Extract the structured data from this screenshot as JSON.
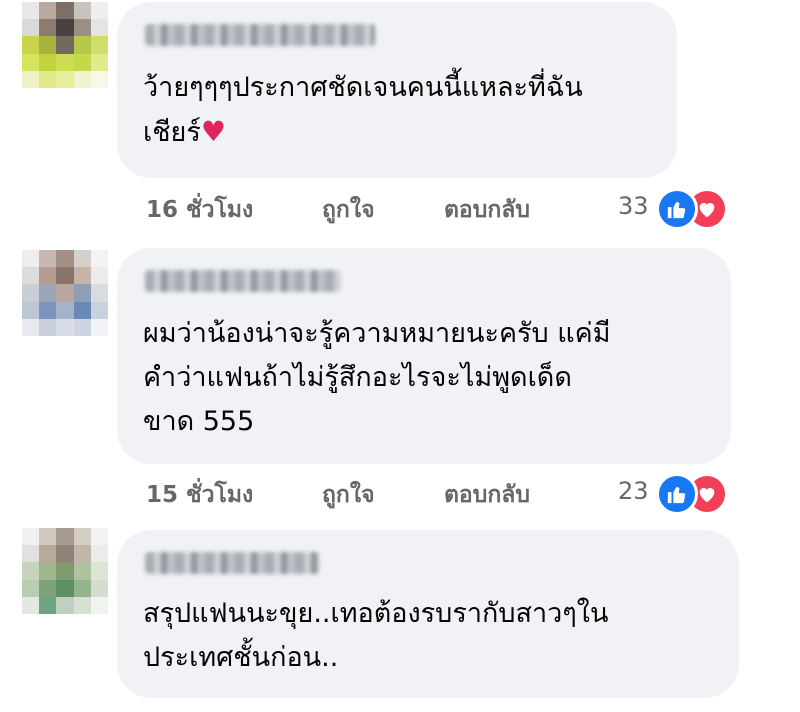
{
  "comments": [
    {
      "text": "ว้ายๆๆๆประกาศชัดเจนคนนี้แหละที่ฉัน\nเชียร์",
      "emoji": "♥",
      "time": "16 ชั่วโมง",
      "like_label": "ถูกใจ",
      "reply_label": "ตอบกลับ",
      "reaction_count": "33",
      "reactions": [
        "like-icon",
        "love-icon"
      ]
    },
    {
      "text": "ผมว่าน้องน่าจะรู้ความหมายนะครับ แค่มี\nคำว่าแฟนถ้าไม่รู้สึกอะไรจะไม่พูดเด็ด\nขาด 555",
      "time": "15 ชั่วโมง",
      "like_label": "ถูกใจ",
      "reply_label": "ตอบกลับ",
      "reaction_count": "23",
      "reactions": [
        "like-icon",
        "love-icon"
      ]
    },
    {
      "text": "สรุปแฟนนะขุย..เทอต้องรบรากับสาวๆใน\nประเทศชั้นก่อน.."
    }
  ],
  "colors": {
    "bubble": "#f0f2f5",
    "text": "#050505",
    "meta": "#65676b",
    "like": "#1877f2",
    "love": "#f33e58"
  }
}
